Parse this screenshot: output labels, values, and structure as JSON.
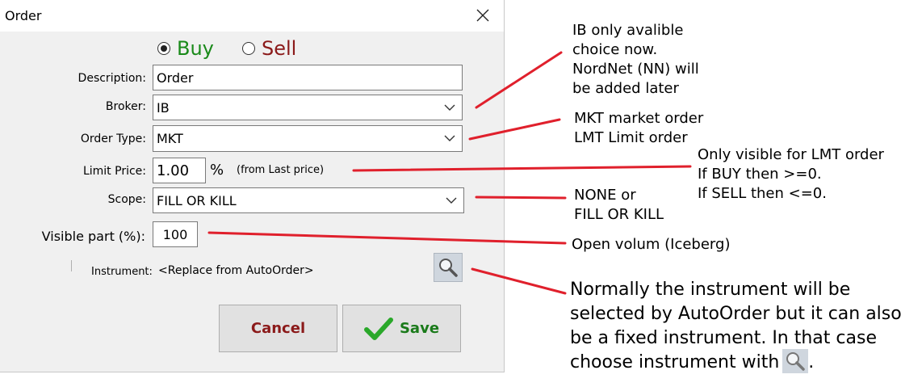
{
  "window": {
    "title": "Order"
  },
  "side": {
    "buy_label": "Buy",
    "sell_label": "Sell",
    "selected": "Buy",
    "buy_color": "#1a8a1a",
    "sell_color": "#8b1a1a"
  },
  "form": {
    "description": {
      "label": "Description:",
      "value": "Order"
    },
    "broker": {
      "label": "Broker:",
      "value": "IB"
    },
    "order_type": {
      "label": "Order Type:",
      "value": "MKT"
    },
    "limit_price": {
      "label": "Limit Price:",
      "value": "1.00",
      "unit": "%",
      "hint": "(from Last price)"
    },
    "scope": {
      "label": "Scope:",
      "value": "FILL OR KILL"
    },
    "visible_part": {
      "label": "Visible part (%):",
      "value": "100"
    },
    "instrument": {
      "label": "Instrument:",
      "value": "<Replace from AutoOrder>"
    }
  },
  "buttons": {
    "cancel": "Cancel",
    "save": "Save",
    "cancel_color": "#8b1a1a",
    "save_color": "#1a7a1a"
  },
  "annotations": {
    "broker": [
      "IB only avalible",
      "choice now.",
      "NordNet (NN) will",
      "be added later"
    ],
    "order_type": [
      "MKT market order",
      "LMT Limit order"
    ],
    "limit_price": [
      "Only visible for LMT order",
      "If BUY then >=0.",
      "If SELL then <=0."
    ],
    "scope": [
      "NONE or",
      "FILL OR KILL"
    ],
    "visible_part": [
      "Open volum (Iceberg)"
    ],
    "instrument": [
      "Normally the instrument will be",
      "selected by AutoOrder but it can also",
      "be a fixed instrument. In that case"
    ],
    "instrument_last": "choose instrument with",
    "instrument_end": "."
  },
  "icons": {
    "close": "close-icon",
    "search": "magnifier-icon",
    "check": "checkmark-icon",
    "chevron": "chevron-down-icon"
  },
  "colors": {
    "arrow": "#e0202c"
  }
}
